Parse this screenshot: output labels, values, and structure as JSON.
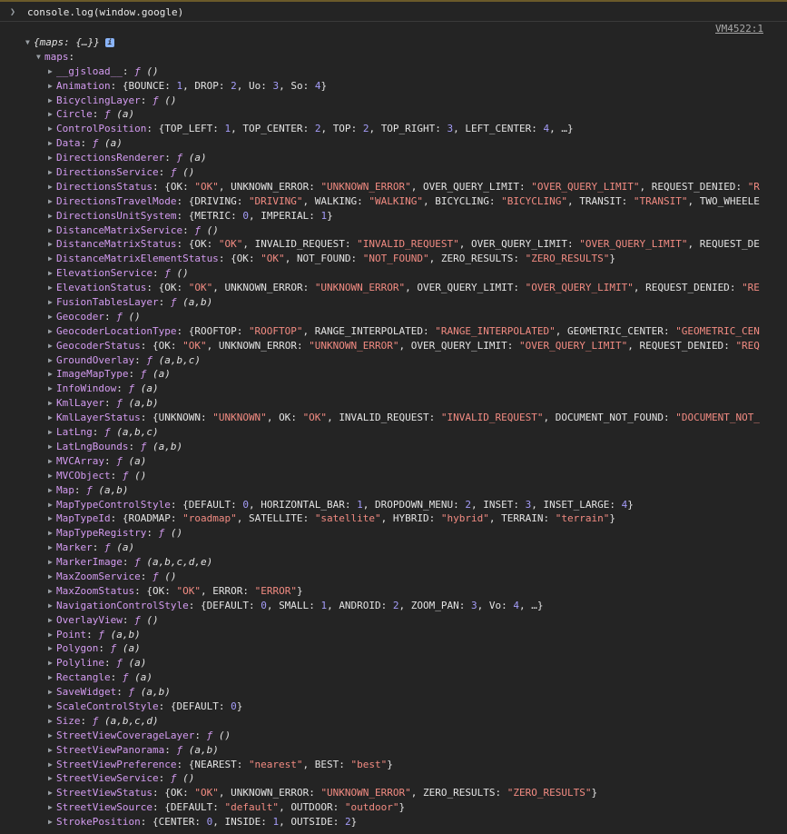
{
  "console": {
    "command": "console.log(window.google)",
    "source_link": "VM4522:1"
  },
  "root": {
    "label": "{maps: {…}}",
    "info": "i"
  },
  "maps_key": "maps",
  "entries": [
    {
      "key": "__gjsload__",
      "value": "ƒ ()",
      "kind": "func"
    },
    {
      "key": "Animation",
      "value": "{BOUNCE: 1, DROP: 2, Uo: 3, So: 4}",
      "kind": "obj"
    },
    {
      "key": "BicyclingLayer",
      "value": "ƒ ()",
      "kind": "func"
    },
    {
      "key": "Circle",
      "value": "ƒ (a)",
      "kind": "func"
    },
    {
      "key": "ControlPosition",
      "value": "{TOP_LEFT: 1, TOP_CENTER: 2, TOP: 2, TOP_RIGHT: 3, LEFT_CENTER: 4, …}",
      "kind": "obj"
    },
    {
      "key": "Data",
      "value": "ƒ (a)",
      "kind": "func"
    },
    {
      "key": "DirectionsRenderer",
      "value": "ƒ (a)",
      "kind": "func"
    },
    {
      "key": "DirectionsService",
      "value": "ƒ ()",
      "kind": "func"
    },
    {
      "key": "DirectionsStatus",
      "value": "{OK: \"OK\", UNKNOWN_ERROR: \"UNKNOWN_ERROR\", OVER_QUERY_LIMIT: \"OVER_QUERY_LIMIT\", REQUEST_DENIED: \"R",
      "kind": "obj"
    },
    {
      "key": "DirectionsTravelMode",
      "value": "{DRIVING: \"DRIVING\", WALKING: \"WALKING\", BICYCLING: \"BICYCLING\", TRANSIT: \"TRANSIT\", TWO_WHEELE",
      "kind": "obj"
    },
    {
      "key": "DirectionsUnitSystem",
      "value": "{METRIC: 0, IMPERIAL: 1}",
      "kind": "obj"
    },
    {
      "key": "DistanceMatrixService",
      "value": "ƒ ()",
      "kind": "func"
    },
    {
      "key": "DistanceMatrixStatus",
      "value": "{OK: \"OK\", INVALID_REQUEST: \"INVALID_REQUEST\", OVER_QUERY_LIMIT: \"OVER_QUERY_LIMIT\", REQUEST_DE",
      "kind": "obj"
    },
    {
      "key": "DistanceMatrixElementStatus",
      "value": "{OK: \"OK\", NOT_FOUND: \"NOT_FOUND\", ZERO_RESULTS: \"ZERO_RESULTS\"}",
      "kind": "obj"
    },
    {
      "key": "ElevationService",
      "value": "ƒ ()",
      "kind": "func"
    },
    {
      "key": "ElevationStatus",
      "value": "{OK: \"OK\", UNKNOWN_ERROR: \"UNKNOWN_ERROR\", OVER_QUERY_LIMIT: \"OVER_QUERY_LIMIT\", REQUEST_DENIED: \"RE",
      "kind": "obj"
    },
    {
      "key": "FusionTablesLayer",
      "value": "ƒ (a,b)",
      "kind": "func"
    },
    {
      "key": "Geocoder",
      "value": "ƒ ()",
      "kind": "func"
    },
    {
      "key": "GeocoderLocationType",
      "value": "{ROOFTOP: \"ROOFTOP\", RANGE_INTERPOLATED: \"RANGE_INTERPOLATED\", GEOMETRIC_CENTER: \"GEOMETRIC_CEN",
      "kind": "obj"
    },
    {
      "key": "GeocoderStatus",
      "value": "{OK: \"OK\", UNKNOWN_ERROR: \"UNKNOWN_ERROR\", OVER_QUERY_LIMIT: \"OVER_QUERY_LIMIT\", REQUEST_DENIED: \"REQ",
      "kind": "obj"
    },
    {
      "key": "GroundOverlay",
      "value": "ƒ (a,b,c)",
      "kind": "func"
    },
    {
      "key": "ImageMapType",
      "value": "ƒ (a)",
      "kind": "func"
    },
    {
      "key": "InfoWindow",
      "value": "ƒ (a)",
      "kind": "func"
    },
    {
      "key": "KmlLayer",
      "value": "ƒ (a,b)",
      "kind": "func"
    },
    {
      "key": "KmlLayerStatus",
      "value": "{UNKNOWN: \"UNKNOWN\", OK: \"OK\", INVALID_REQUEST: \"INVALID_REQUEST\", DOCUMENT_NOT_FOUND: \"DOCUMENT_NOT_",
      "kind": "obj"
    },
    {
      "key": "LatLng",
      "value": "ƒ (a,b,c)",
      "kind": "func"
    },
    {
      "key": "LatLngBounds",
      "value": "ƒ (a,b)",
      "kind": "func"
    },
    {
      "key": "MVCArray",
      "value": "ƒ (a)",
      "kind": "func"
    },
    {
      "key": "MVCObject",
      "value": "ƒ ()",
      "kind": "func"
    },
    {
      "key": "Map",
      "value": "ƒ (a,b)",
      "kind": "func"
    },
    {
      "key": "MapTypeControlStyle",
      "value": "{DEFAULT: 0, HORIZONTAL_BAR: 1, DROPDOWN_MENU: 2, INSET: 3, INSET_LARGE: 4}",
      "kind": "obj"
    },
    {
      "key": "MapTypeId",
      "value": "{ROADMAP: \"roadmap\", SATELLITE: \"satellite\", HYBRID: \"hybrid\", TERRAIN: \"terrain\"}",
      "kind": "obj"
    },
    {
      "key": "MapTypeRegistry",
      "value": "ƒ ()",
      "kind": "func"
    },
    {
      "key": "Marker",
      "value": "ƒ (a)",
      "kind": "func"
    },
    {
      "key": "MarkerImage",
      "value": "ƒ (a,b,c,d,e)",
      "kind": "func"
    },
    {
      "key": "MaxZoomService",
      "value": "ƒ ()",
      "kind": "func"
    },
    {
      "key": "MaxZoomStatus",
      "value": "{OK: \"OK\", ERROR: \"ERROR\"}",
      "kind": "obj"
    },
    {
      "key": "NavigationControlStyle",
      "value": "{DEFAULT: 0, SMALL: 1, ANDROID: 2, ZOOM_PAN: 3, Vo: 4, …}",
      "kind": "obj"
    },
    {
      "key": "OverlayView",
      "value": "ƒ ()",
      "kind": "func"
    },
    {
      "key": "Point",
      "value": "ƒ (a,b)",
      "kind": "func"
    },
    {
      "key": "Polygon",
      "value": "ƒ (a)",
      "kind": "func"
    },
    {
      "key": "Polyline",
      "value": "ƒ (a)",
      "kind": "func"
    },
    {
      "key": "Rectangle",
      "value": "ƒ (a)",
      "kind": "func"
    },
    {
      "key": "SaveWidget",
      "value": "ƒ (a,b)",
      "kind": "func"
    },
    {
      "key": "ScaleControlStyle",
      "value": "{DEFAULT: 0}",
      "kind": "obj"
    },
    {
      "key": "Size",
      "value": "ƒ (a,b,c,d)",
      "kind": "func"
    },
    {
      "key": "StreetViewCoverageLayer",
      "value": "ƒ ()",
      "kind": "func"
    },
    {
      "key": "StreetViewPanorama",
      "value": "ƒ (a,b)",
      "kind": "func"
    },
    {
      "key": "StreetViewPreference",
      "value": "{NEAREST: \"nearest\", BEST: \"best\"}",
      "kind": "obj"
    },
    {
      "key": "StreetViewService",
      "value": "ƒ ()",
      "kind": "func"
    },
    {
      "key": "StreetViewStatus",
      "value": "{OK: \"OK\", UNKNOWN_ERROR: \"UNKNOWN_ERROR\", ZERO_RESULTS: \"ZERO_RESULTS\"}",
      "kind": "obj"
    },
    {
      "key": "StreetViewSource",
      "value": "{DEFAULT: \"default\", OUTDOOR: \"outdoor\"}",
      "kind": "obj"
    },
    {
      "key": "StrokePosition",
      "value": "{CENTER: 0, INSIDE: 1, OUTSIDE: 2}",
      "kind": "obj"
    }
  ],
  "icons": {
    "prompt": "chevron-right-icon",
    "expanded": "triangle-down-icon",
    "collapsed": "triangle-right-icon"
  }
}
